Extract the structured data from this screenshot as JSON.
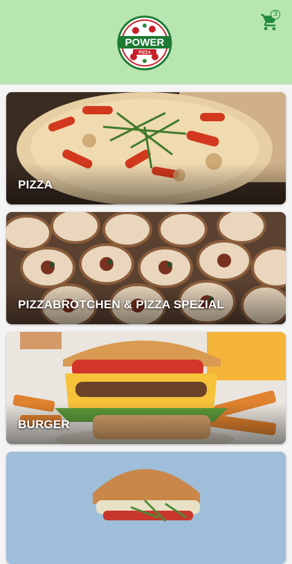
{
  "header": {
    "logo_text": "POWER",
    "logo_subtext": "PIZZA",
    "cart_count": "3",
    "background": "#b7e6b0",
    "accent": "#1f8a3b"
  },
  "categories": [
    {
      "label": "PIZZA"
    },
    {
      "label": "PIZZABRÖTCHEN & PIZZA SPEZIAL"
    },
    {
      "label": "BURGER"
    },
    {
      "label": ""
    }
  ]
}
